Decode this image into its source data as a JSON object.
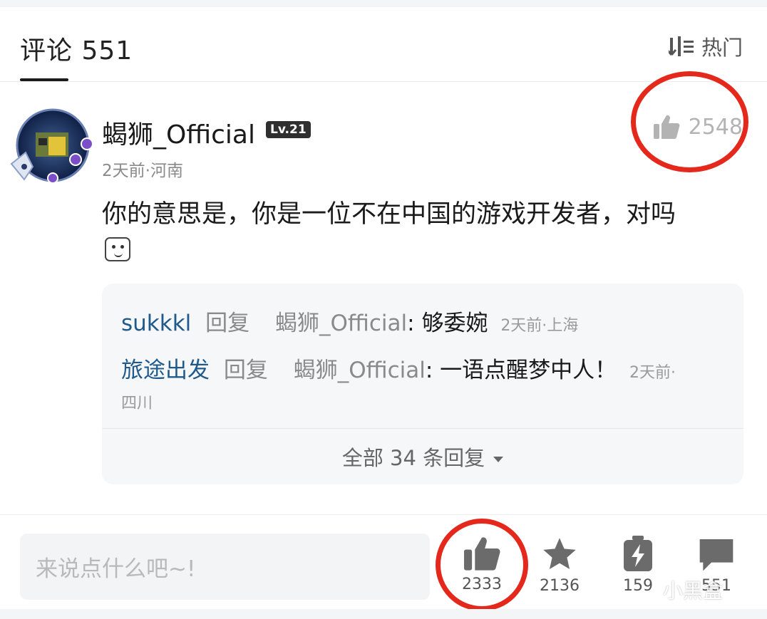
{
  "header": {
    "title": "评论 551",
    "sort_label": "热门"
  },
  "comment": {
    "username": "蝎狮_Official",
    "level": "Lv.21",
    "meta": "2天前·河南",
    "likes": "2548",
    "text": "你的意思是，你是一位不在中国的游戏开发者，对吗"
  },
  "replies": {
    "items": [
      {
        "user": "sukkkl",
        "action": "回复",
        "target": "蝎狮_Official",
        "text": ": 够委婉",
        "meta": "2天前·上海"
      },
      {
        "user": "旅途出发",
        "action": "回复",
        "target": "蝎狮_Official",
        "text": ": 一语点醒梦中人！",
        "meta": "2天前·",
        "meta2": "四川"
      }
    ],
    "show_all": "全部 34 条回复"
  },
  "bottom": {
    "input_placeholder": "来说点什么吧~!",
    "like_count": "2333",
    "star_count": "2136",
    "charge_count": "159",
    "comment_count": "551"
  },
  "watermark": "小黑盒",
  "colors": {
    "annotation_red": "#e4281c",
    "reply_user_blue": "#1f5a8b"
  }
}
